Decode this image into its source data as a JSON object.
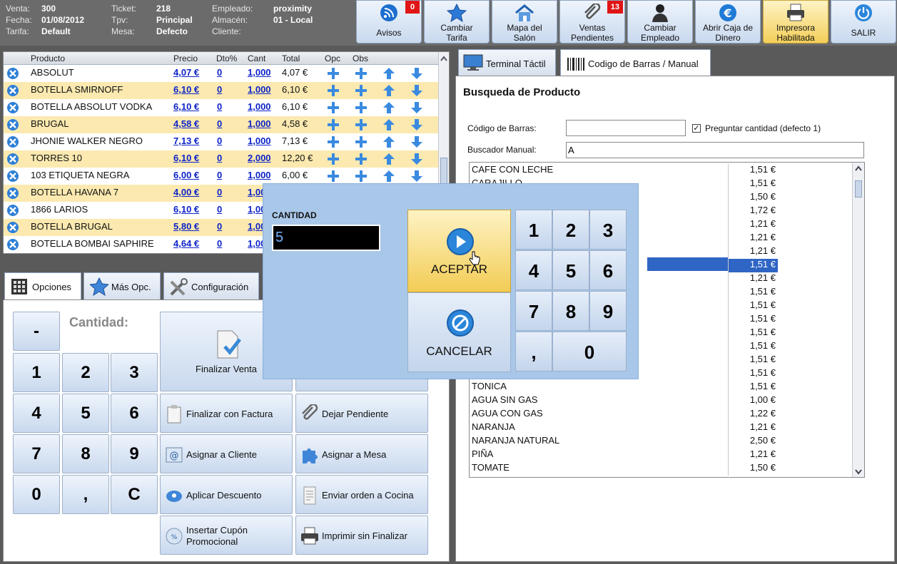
{
  "header": {
    "info": [
      {
        "label": "Venta:",
        "value": "300"
      },
      {
        "label": "Fecha:",
        "value": "01/08/2012"
      },
      {
        "label": "Tarifa:",
        "value": "Default"
      },
      {
        "label": "Ticket:",
        "value": "218"
      },
      {
        "label": "Tpv:",
        "value": "Principal"
      },
      {
        "label": "Mesa:",
        "value": "Defecto"
      },
      {
        "label": "Empleado:",
        "value": "proximity"
      },
      {
        "label": "Almacén:",
        "value": "01 - Local"
      },
      {
        "label": "Cliente:",
        "value": ""
      }
    ],
    "buttons": [
      {
        "label": "Avisos",
        "badge": "0",
        "icon": "rss-icon"
      },
      {
        "label": "Cambiar\nTarifa",
        "icon": "star-icon"
      },
      {
        "label": "Mapa del\nSalón",
        "icon": "house-icon"
      },
      {
        "label": "Ventas\nPendientes",
        "badge": "13",
        "icon": "paperclip-icon"
      },
      {
        "label": "Cambiar\nEmpleado",
        "icon": "person-icon"
      },
      {
        "label": "Abrir Caja de\nDinero",
        "icon": "euro-icon"
      },
      {
        "label": "Impresora\nHabilitada",
        "icon": "printer-icon"
      },
      {
        "label": "SALIR",
        "icon": "power-icon"
      }
    ]
  },
  "ticket": {
    "columns": [
      "Producto",
      "Precio",
      "Dto%",
      "Cant",
      "Total",
      "Opc",
      "Obs"
    ],
    "rows": [
      {
        "product": "ABSOLUT",
        "price": "4,07 €",
        "dto": "0",
        "qty": "1,000",
        "total": "4,07 €"
      },
      {
        "product": "BOTELLA SMIRNOFF",
        "price": "6,10 €",
        "dto": "0",
        "qty": "1,000",
        "total": "6,10 €"
      },
      {
        "product": "BOTELLA ABSOLUT VODKA",
        "price": "6,10 €",
        "dto": "0",
        "qty": "1,000",
        "total": "6,10 €"
      },
      {
        "product": "BRUGAL",
        "price": "4,58 €",
        "dto": "0",
        "qty": "1,000",
        "total": "4,58 €"
      },
      {
        "product": "JHONIE WALKER NEGRO",
        "price": "7,13 €",
        "dto": "0",
        "qty": "1,000",
        "total": "7,13 €"
      },
      {
        "product": "TORRES 10",
        "price": "6,10 €",
        "dto": "0",
        "qty": "2,000",
        "total": "12,20 €"
      },
      {
        "product": "103 ETIQUETA NEGRA",
        "price": "6,00 €",
        "dto": "0",
        "qty": "1,000",
        "total": "6,00 €"
      },
      {
        "product": "BOTELLA HAVANA 7",
        "price": "4,00 €",
        "dto": "0",
        "qty": "1,00",
        "total": ""
      },
      {
        "product": "1866 LARIOS",
        "price": "6,10 €",
        "dto": "0",
        "qty": "1,00",
        "total": ""
      },
      {
        "product": "BOTELLA BRUGAL",
        "price": "5,80 €",
        "dto": "0",
        "qty": "1,00",
        "total": ""
      },
      {
        "product": "BOTELLA BOMBAI SAPHIRE",
        "price": "4,64 €",
        "dto": "0",
        "qty": "1,00",
        "total": ""
      }
    ]
  },
  "left_tabs": [
    "Opciones",
    "Más Opc.",
    "Configuración"
  ],
  "keypad": {
    "minus": "-",
    "qty_label": "Cantidad:",
    "keys": [
      "1",
      "2",
      "3",
      "4",
      "5",
      "6",
      "7",
      "8",
      "9",
      "0",
      ",",
      "C"
    ]
  },
  "actions": {
    "finalizar_venta": "Finalizar Venta",
    "factura": "Finalizar con Factura",
    "pendiente": "Dejar Pendiente",
    "cliente": "Asignar a Cliente",
    "mesa": "Asignar a Mesa",
    "descuento": "Aplicar Descuento",
    "cocina": "Enviar orden a Cocina",
    "cupon": "Insertar Cupón\nPromocional",
    "imprimir": "Imprimir sin Finalizar"
  },
  "right_tabs": [
    "Terminal Táctil",
    "Codigo de Barras / Manual"
  ],
  "search": {
    "title": "Busqueda de Producto",
    "barcode_label": "Código de Barras:",
    "barcode_value": "",
    "ask_qty_label": "Preguntar cantidad (defecto 1)",
    "ask_qty_checked": true,
    "manual_label": "Buscador Manual:",
    "manual_value": "A"
  },
  "results": [
    {
      "name": "CAFE CON LECHE",
      "price": "1,51 €"
    },
    {
      "name": "CARAJILLO",
      "price": "1,51 €"
    },
    {
      "name": "",
      "price": "1,50 €"
    },
    {
      "name": "",
      "price": "1,72 €"
    },
    {
      "name": "",
      "price": "1,21 €"
    },
    {
      "name": "",
      "price": "1,21 €"
    },
    {
      "name": "",
      "price": "1,21 €"
    },
    {
      "name": "",
      "price": "1,51 €",
      "selected": true
    },
    {
      "name": "",
      "price": "1,21 €"
    },
    {
      "name": "",
      "price": "1,51 €"
    },
    {
      "name": "",
      "price": "1,51 €"
    },
    {
      "name": "",
      "price": "1,51 €"
    },
    {
      "name": "",
      "price": "1,51 €"
    },
    {
      "name": "",
      "price": "1,51 €"
    },
    {
      "name": "",
      "price": "1,51 €"
    },
    {
      "name": "",
      "price": "1,51 €"
    },
    {
      "name": "TONICA",
      "price": "1,51 €"
    },
    {
      "name": "AGUA SIN GAS",
      "price": "1,00 €"
    },
    {
      "name": "AGUA CON GAS",
      "price": "1,22 €"
    },
    {
      "name": "NARANJA",
      "price": "1,21 €"
    },
    {
      "name": "NARANJA NATURAL",
      "price": "2,50 €"
    },
    {
      "name": "PIÑA",
      "price": "1,21 €"
    },
    {
      "name": "TOMATE",
      "price": "1,50 €"
    }
  ],
  "dialog": {
    "label": "CANTIDAD",
    "value": "5",
    "accept": "ACEPTAR",
    "cancel": "CANCELAR",
    "keys": [
      "1",
      "2",
      "3",
      "4",
      "5",
      "6",
      "7",
      "8",
      "9",
      ",",
      "0"
    ]
  }
}
